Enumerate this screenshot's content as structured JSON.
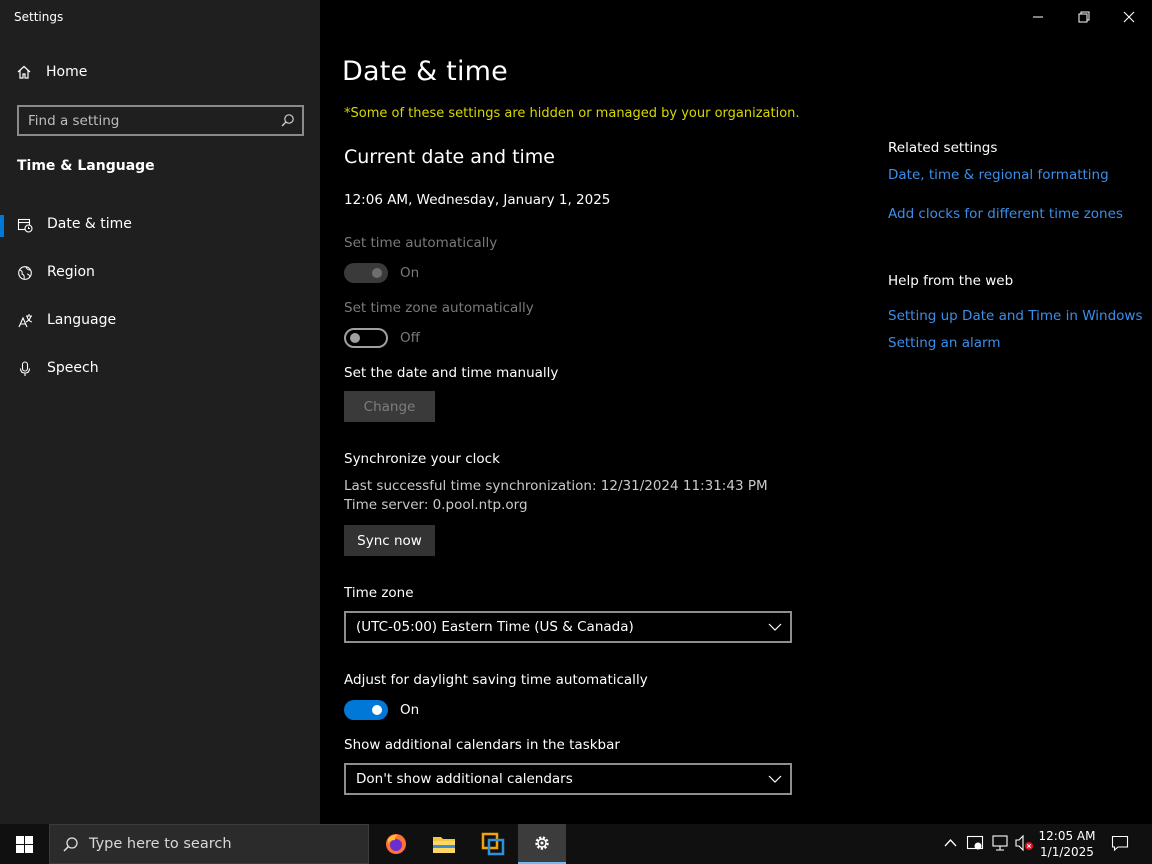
{
  "window": {
    "title": "Settings"
  },
  "sidebar": {
    "home": "Home",
    "search_placeholder": "Find a setting",
    "section": "Time & Language",
    "items": [
      {
        "label": "Date & time",
        "icon": "calendar-clock-icon",
        "active": true
      },
      {
        "label": "Region",
        "icon": "globe-icon",
        "active": false
      },
      {
        "label": "Language",
        "icon": "language-icon",
        "active": false
      },
      {
        "label": "Speech",
        "icon": "microphone-icon",
        "active": false
      }
    ]
  },
  "main": {
    "title": "Date & time",
    "org_note": "*Some of these settings are hidden or managed by your organization.",
    "current_heading": "Current date and time",
    "current_datetime": "12:06 AM, Wednesday, January 1, 2025",
    "set_time_auto": {
      "label": "Set time automatically",
      "state": "On"
    },
    "set_tz_auto": {
      "label": "Set time zone automatically",
      "state": "Off"
    },
    "manual": {
      "label": "Set the date and time manually",
      "button": "Change"
    },
    "sync": {
      "heading": "Synchronize your clock",
      "last": "Last successful time synchronization: 12/31/2024 11:31:43 PM",
      "server": "Time server: 0.pool.ntp.org",
      "button": "Sync now"
    },
    "timezone": {
      "label": "Time zone",
      "value": "(UTC-05:00) Eastern Time (US & Canada)"
    },
    "dst": {
      "label": "Adjust for daylight saving time automatically",
      "state": "On"
    },
    "calendars": {
      "label": "Show additional calendars in the taskbar",
      "value": "Don't show additional calendars"
    }
  },
  "related": {
    "heading": "Related settings",
    "links": [
      "Date, time & regional formatting",
      "Add clocks for different time zones"
    ],
    "help_heading": "Help from the web",
    "help_links": [
      "Setting up Date and Time in Windows",
      "Setting an alarm"
    ]
  },
  "taskbar": {
    "search_placeholder": "Type here to search",
    "time": "12:05 AM",
    "date": "1/1/2025"
  },
  "colors": {
    "accent": "#0078d7",
    "link": "#3b8eea",
    "warning": "#d8d800"
  }
}
